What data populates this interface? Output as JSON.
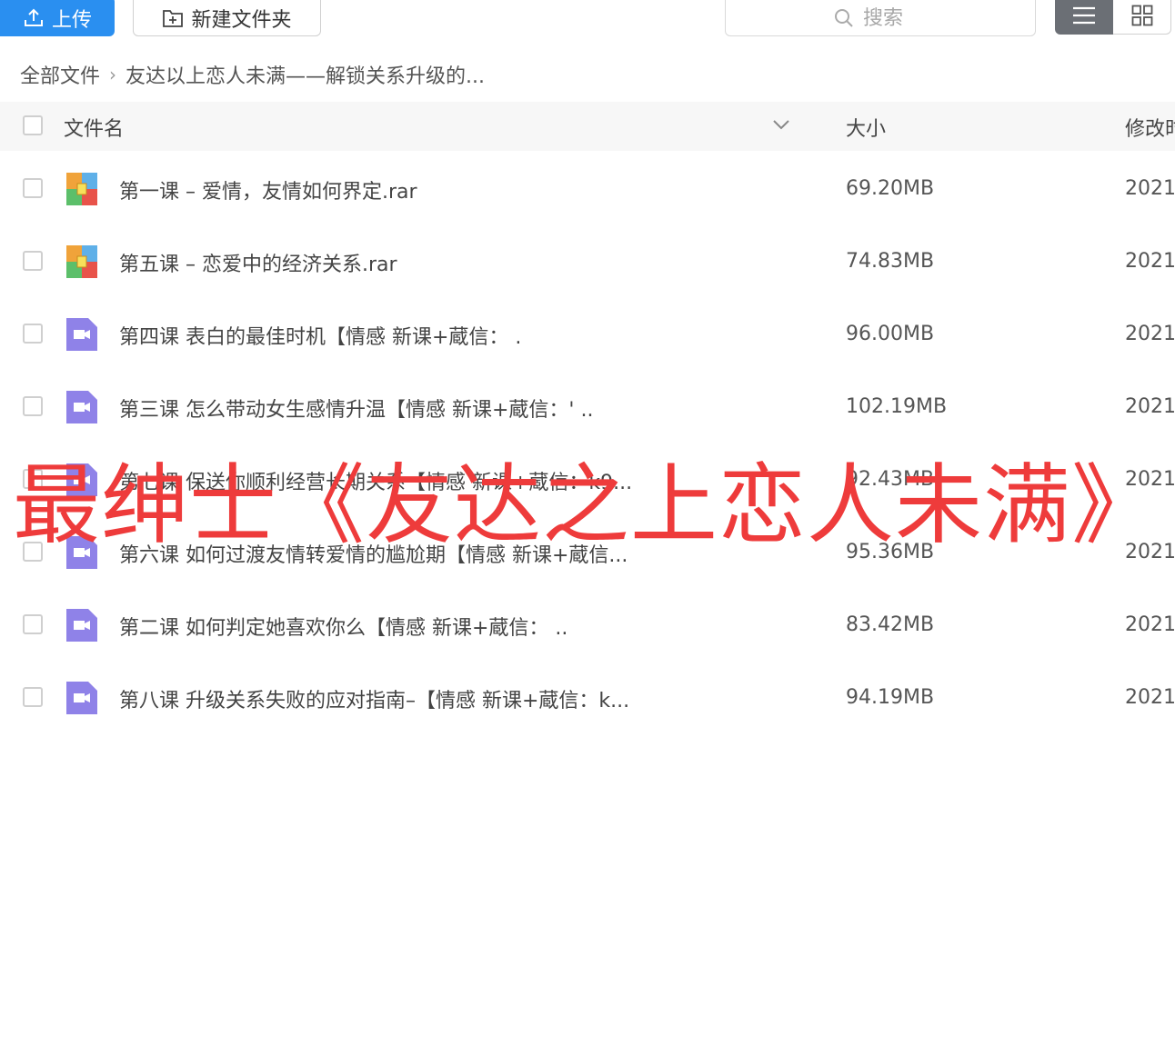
{
  "toolbar": {
    "upload_label": "上传",
    "new_folder_label": "新建文件夹",
    "search_placeholder": "搜索"
  },
  "breadcrumb": {
    "root": "全部文件",
    "current": "友达以上恋人未满——解锁关系升级的..."
  },
  "table": {
    "headers": {
      "name": "文件名",
      "size": "大小",
      "date": "修改时"
    },
    "rows": [
      {
        "name": "第一课 – 爱情，友情如何界定.rar",
        "size": "69.20MB",
        "date": "2021.",
        "icon": "archive-icon"
      },
      {
        "name": "第五课 – 恋爱中的经济关系.rar",
        "size": "74.83MB",
        "date": "2021.",
        "icon": "archive-icon"
      },
      {
        "name": "第四课 表白的最佳时机【情感 新课+蔵信：            .",
        "size": "96.00MB",
        "date": "2021.",
        "icon": "video-file-icon"
      },
      {
        "name": "第三课 怎么带动女生感情升温【情感 新课+蔵信：'      ..",
        "size": "102.19MB",
        "date": "2021.",
        "icon": "video-file-icon"
      },
      {
        "name": "第七课 保送你顺利经营长期关系【情感 新课+蔵信：k9...",
        "size": "92.43MB",
        "date": "2021.",
        "icon": "video-file-icon"
      },
      {
        "name": "第六课 如何过渡友情转爱情的尴尬期【情感 新课+蔵信...",
        "size": "95.36MB",
        "date": "2021.",
        "icon": "video-file-icon"
      },
      {
        "name": "第二课 如何判定她喜欢你么【情感 新课+蔵信：       ..",
        "size": "83.42MB",
        "date": "2021.",
        "icon": "video-file-icon"
      },
      {
        "name": "第八课 升级关系失败的应对指南–【情感 新课+蔵信：k...",
        "size": "94.19MB",
        "date": "2021.",
        "icon": "video-file-icon"
      }
    ]
  },
  "watermark": "最绅士《友达之上恋人未满》",
  "colors": {
    "accent": "#2a8ff0",
    "watermark": "#ee3b3b",
    "video_icon": "#8f82e8"
  }
}
